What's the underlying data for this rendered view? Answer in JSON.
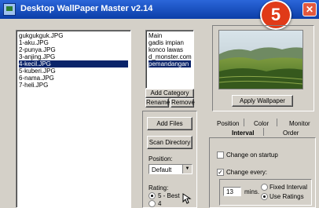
{
  "window": {
    "title": "Desktop WallPaper Master v2.14",
    "close_glyph": "✕",
    "step_badge": "5"
  },
  "files": {
    "items": [
      "gukgukguk.JPG",
      "1-aku.JPG",
      "2-punya.JPG",
      "3-anjing.JPG",
      "4-kecil.JPG",
      "5-kuberi.JPG",
      "6-nama.JPG",
      "7-heli.JPG"
    ],
    "selected_index": 4
  },
  "categories": {
    "items": [
      "Main",
      "gadis impian",
      "konco lawas",
      "d_monster.com",
      "pemandangan"
    ],
    "selected_index": 4
  },
  "buttons": {
    "add_category": "Add Category",
    "rename": "Rename",
    "remove": "Remove",
    "add_files": "Add Files",
    "scan_directory": "Scan Directory",
    "apply_wallpaper": "Apply Wallpaper"
  },
  "position": {
    "label": "Position:",
    "value": "Default"
  },
  "rating": {
    "label": "Rating:",
    "options": [
      "5 - Best",
      "4"
    ],
    "selected_index": 0
  },
  "tabs": {
    "row1": [
      "Position",
      "Color",
      "Monitor"
    ],
    "row2": [
      "Interval",
      "Order"
    ],
    "active": "Interval"
  },
  "interval": {
    "change_on_startup": {
      "label": "Change on startup",
      "checked": false
    },
    "change_every": {
      "label": "Change every:",
      "checked": true
    },
    "minutes_value": "13",
    "minutes_unit": "mins.",
    "modes": [
      "Fixed Interval",
      "Use Ratings"
    ],
    "mode_selected_index": 1
  },
  "icons": [
    "app-icon",
    "close-icon",
    "dropdown-arrow-icon",
    "cursor-icon"
  ]
}
